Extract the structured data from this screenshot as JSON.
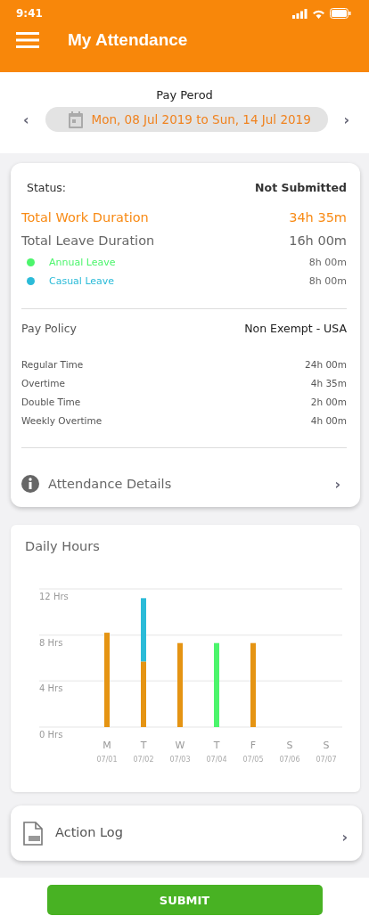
{
  "status_bar": {
    "time": "9:41"
  },
  "header": {
    "title": "My Attendance"
  },
  "pay_period": {
    "label": "Pay Perod",
    "range": "Mon, 08 Jul 2019 to Sun, 14 Jul 2019",
    "prev": "‹",
    "next": "›"
  },
  "summary": {
    "status_label": "Status:",
    "status_value": "Not Submitted",
    "work_label": "Total Work Duration",
    "work_value": "34h 35m",
    "leave_label": "Total Leave Duration",
    "leave_value": "16h 00m",
    "leaves": [
      {
        "name": "Annual Leave",
        "value": "8h 00m",
        "color": "#4cf56c"
      },
      {
        "name": "Casual Leave",
        "value": "8h 00m",
        "color": "#2bbbd8"
      }
    ],
    "policy_label": "Pay Policy",
    "policy_value": "Non Exempt - USA",
    "times": [
      {
        "label": "Regular Time",
        "value": "24h 00m"
      },
      {
        "label": "Overtime",
        "value": "4h 35m"
      },
      {
        "label": "Double Time",
        "value": "2h 00m"
      },
      {
        "label": "Weekly Overtime",
        "value": "4h 00m"
      }
    ],
    "details_link": {
      "label": "Attendance Details",
      "chevron": "›"
    }
  },
  "daily_hours": {
    "title": "Daily Hours",
    "chart_data": {
      "type": "bar",
      "stacked": true,
      "categories": [
        "M\n07/01",
        "T\n07/02",
        "W\n07/03",
        "T\n07/04",
        "F\n07/05",
        "S\n07/06",
        "S\n07/07"
      ],
      "ylim": [
        0,
        12
      ],
      "yticks": [
        {
          "value": 0,
          "label": "0 Hrs"
        },
        {
          "value": 4,
          "label": "4 Hrs"
        },
        {
          "value": 8,
          "label": "8 Hrs"
        },
        {
          "value": 12,
          "label": "12 Hrs"
        }
      ],
      "series": [
        {
          "color": "#e59413",
          "values": [
            8.2,
            5.7,
            7.3,
            0,
            7.3,
            0,
            0
          ]
        },
        {
          "color": "#2bbbd8",
          "values": [
            0,
            5.5,
            0,
            0,
            0,
            0,
            0
          ]
        },
        {
          "color": "#4cf56c",
          "values": [
            0,
            0,
            0,
            7.3,
            0,
            0,
            0
          ]
        }
      ]
    }
  },
  "action_log": {
    "label": "Action Log",
    "chevron": "›"
  },
  "submit": {
    "label": "SUBMIT"
  }
}
